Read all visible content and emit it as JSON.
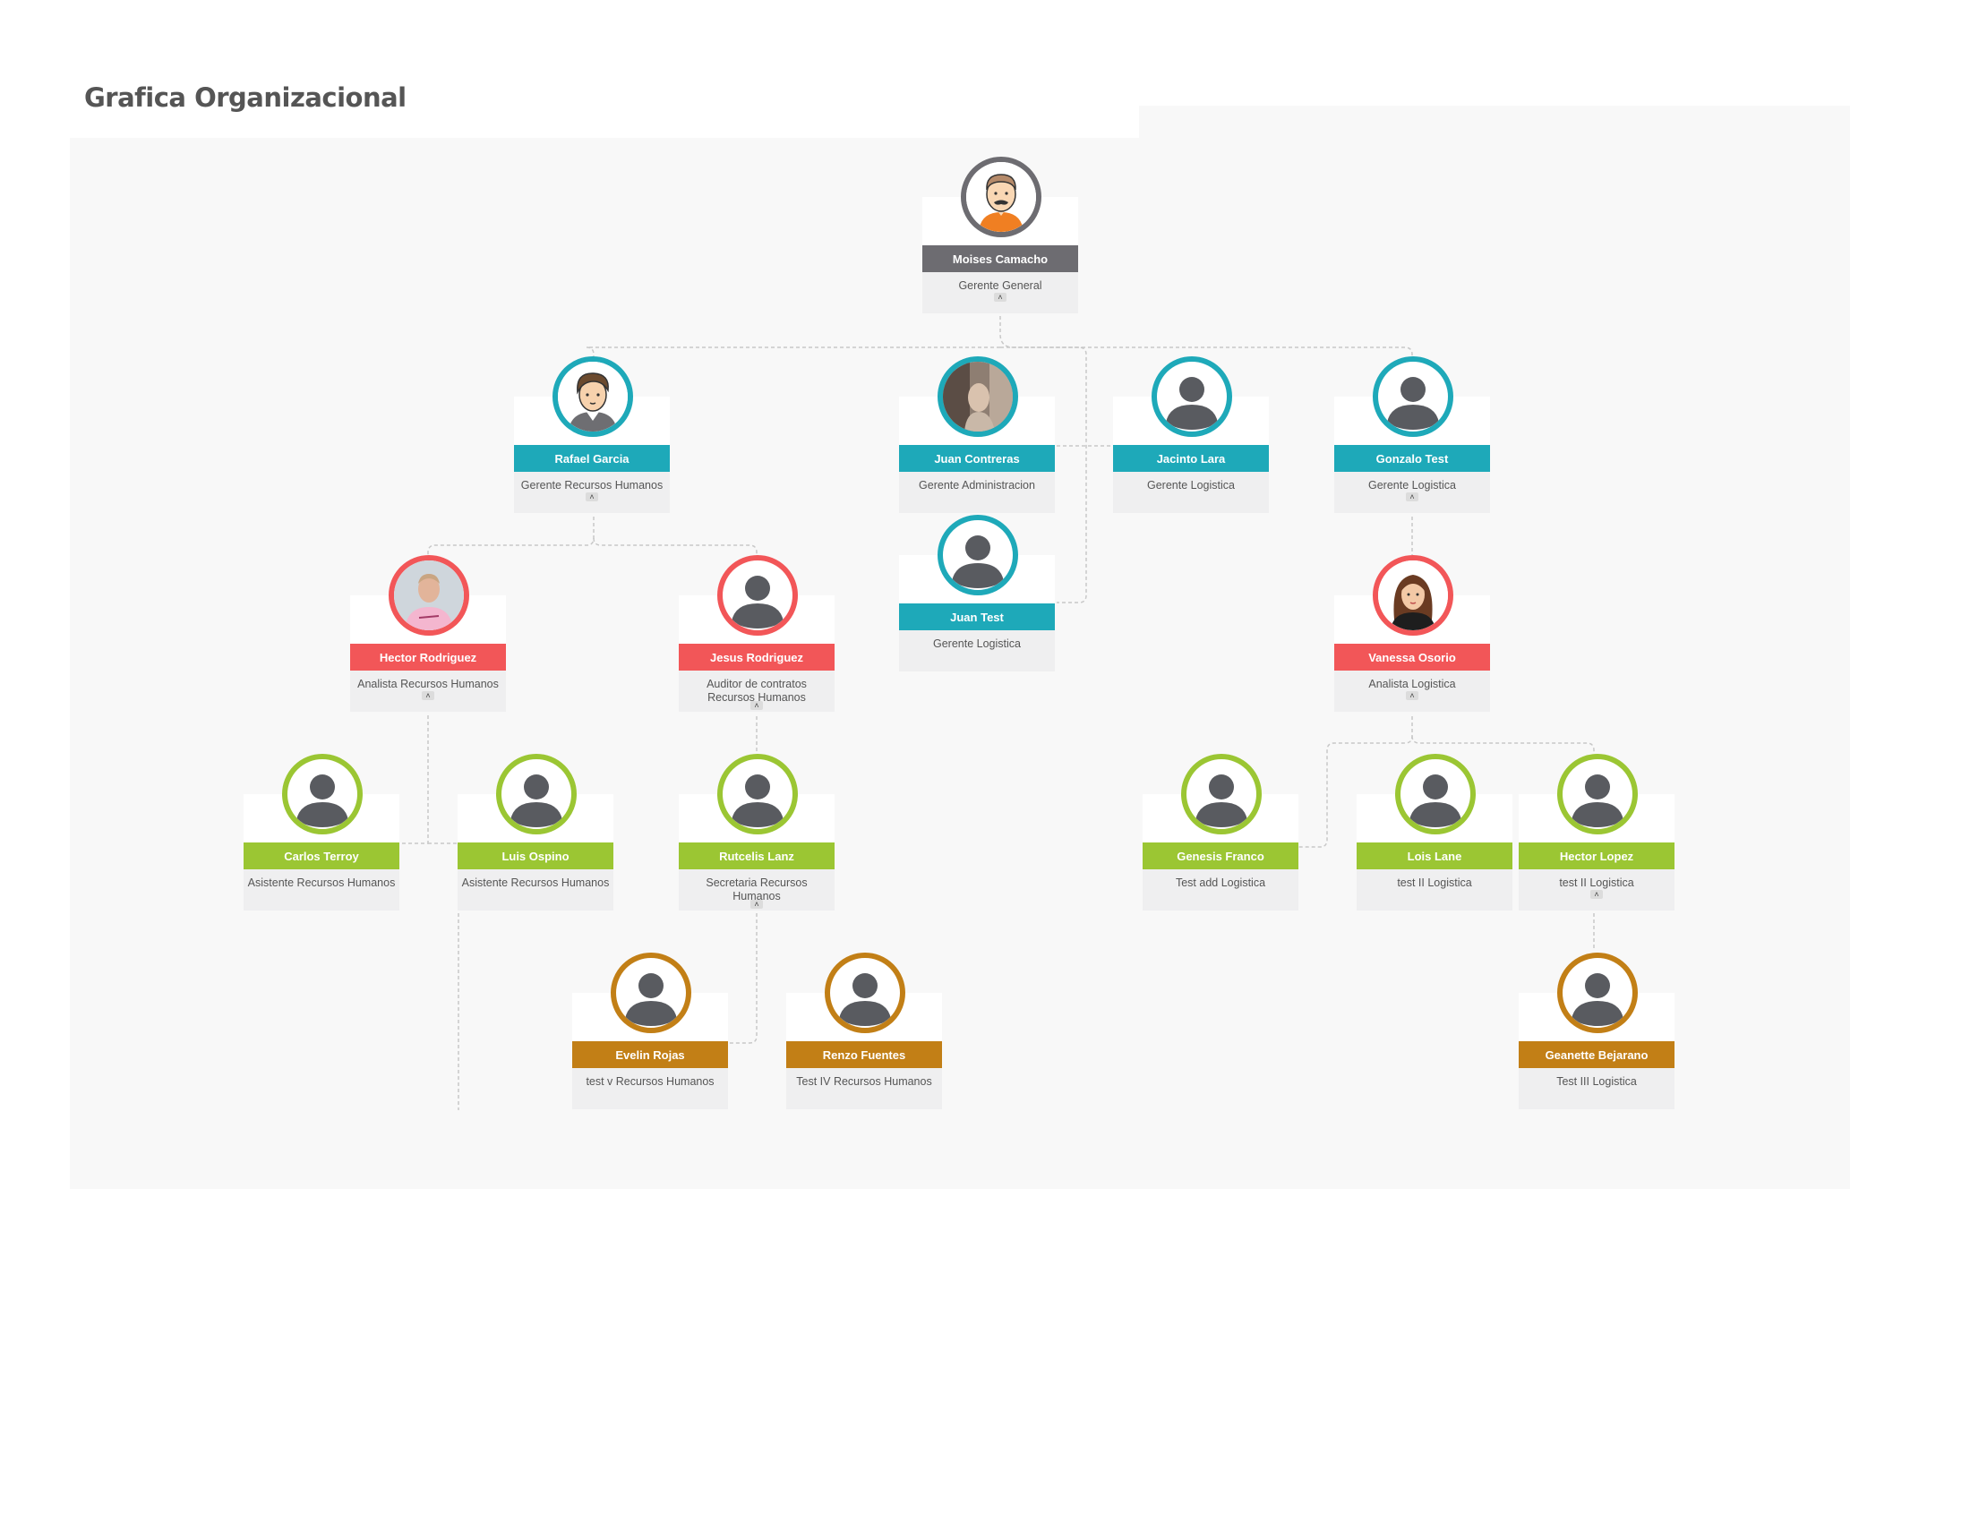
{
  "page": {
    "title": "Grafica Organizacional"
  },
  "colors": {
    "gray": "#6d6c71",
    "teal": "#1ea9b9",
    "red": "#f25658",
    "green": "#9bc633",
    "gold": "#c27f16"
  },
  "nodes": [
    {
      "id": "moises",
      "name": "Moises Camacho",
      "title": "Gerente General",
      "color": "gray",
      "avatar": "male-cartoon-mustache-icon",
      "expand_toggle": true
    },
    {
      "id": "rafael",
      "name": "Rafael Garcia",
      "title": "Gerente Recursos Humanos",
      "color": "teal",
      "avatar": "male-cartoon-avatar-icon",
      "expand_toggle": true
    },
    {
      "id": "juanc",
      "name": "Juan Contreras",
      "title": "Gerente Administracion",
      "color": "teal",
      "avatar": "profile-photo",
      "expand_toggle": false
    },
    {
      "id": "jacinto",
      "name": "Jacinto Lara",
      "title": "Gerente Logistica",
      "color": "teal",
      "avatar": "user-silhouette-icon",
      "expand_toggle": false
    },
    {
      "id": "gonzalo",
      "name": "Gonzalo Test",
      "title": "Gerente Logistica",
      "color": "teal",
      "avatar": "user-silhouette-icon",
      "expand_toggle": true
    },
    {
      "id": "juant",
      "name": "Juan Test",
      "title": "Gerente Logistica",
      "color": "teal",
      "avatar": "user-silhouette-icon",
      "expand_toggle": false
    },
    {
      "id": "hectorr",
      "name": "Hector Rodriguez",
      "title": "Analista Recursos Humanos",
      "color": "red",
      "avatar": "profile-photo",
      "expand_toggle": true
    },
    {
      "id": "jesus",
      "name": "Jesus Rodriguez",
      "title": "Auditor de contratos Recursos Humanos",
      "color": "red",
      "avatar": "user-silhouette-icon",
      "expand_toggle": true
    },
    {
      "id": "vanessa",
      "name": "Vanessa Osorio",
      "title": "Analista Logistica",
      "color": "red",
      "avatar": "female-cartoon-avatar-icon",
      "expand_toggle": true
    },
    {
      "id": "carlos",
      "name": "Carlos Terroy",
      "title": "Asistente Recursos Humanos",
      "color": "green",
      "avatar": "user-silhouette-icon",
      "expand_toggle": false
    },
    {
      "id": "luis",
      "name": "Luis Ospino",
      "title": "Asistente Recursos Humanos",
      "color": "green",
      "avatar": "user-silhouette-icon",
      "expand_toggle": false
    },
    {
      "id": "rutcelis",
      "name": "Rutcelis Lanz",
      "title": "Secretaria Recursos Humanos",
      "color": "green",
      "avatar": "user-silhouette-icon",
      "expand_toggle": true
    },
    {
      "id": "genesis",
      "name": "Genesis Franco",
      "title": "Test add Logistica",
      "color": "green",
      "avatar": "user-silhouette-icon",
      "expand_toggle": false
    },
    {
      "id": "lois",
      "name": "Lois Lane",
      "title": "test II Logistica",
      "color": "green",
      "avatar": "user-silhouette-icon",
      "expand_toggle": false
    },
    {
      "id": "hectorl",
      "name": "Hector Lopez",
      "title": "test II Logistica",
      "color": "green",
      "avatar": "user-silhouette-icon",
      "expand_toggle": true
    },
    {
      "id": "evelin",
      "name": "Evelin Rojas",
      "title": "test v Recursos Humanos",
      "color": "gold",
      "avatar": "user-silhouette-icon",
      "expand_toggle": false
    },
    {
      "id": "renzo",
      "name": "Renzo Fuentes",
      "title": "Test IV Recursos Humanos",
      "color": "gold",
      "avatar": "user-silhouette-icon",
      "expand_toggle": false
    },
    {
      "id": "geanette",
      "name": "Geanette Bejarano",
      "title": "Test III Logistica",
      "color": "gold",
      "avatar": "user-silhouette-icon",
      "expand_toggle": false
    }
  ],
  "toggle_glyph": "˄"
}
